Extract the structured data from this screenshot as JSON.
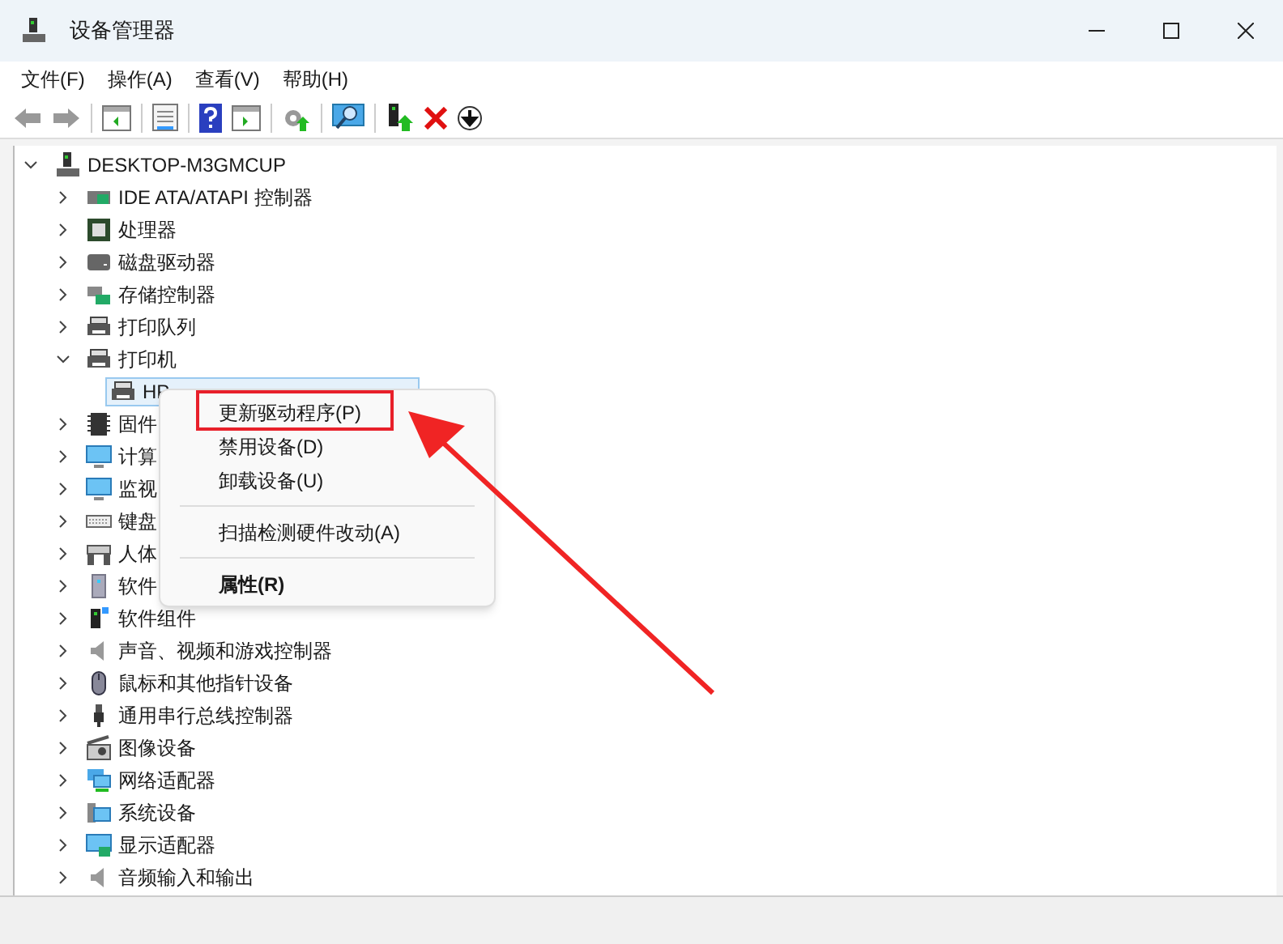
{
  "window": {
    "title": "设备管理器"
  },
  "menu_bar": [
    "文件(F)",
    "操作(A)",
    "查看(V)",
    "帮助(H)"
  ],
  "tree": {
    "label": "DESKTOP-M3GMCUP",
    "expanded": true,
    "children": [
      {
        "label": "IDE ATA/ATAPI 控制器",
        "expanded": false
      },
      {
        "label": "处理器",
        "expanded": false
      },
      {
        "label": "磁盘驱动器",
        "expanded": false
      },
      {
        "label": "存储控制器",
        "expanded": false
      },
      {
        "label": "打印队列",
        "expanded": false
      },
      {
        "label": "打印机",
        "expanded": true,
        "children": [
          {
            "label": "HP",
            "selected": true
          }
        ]
      },
      {
        "label": "固件",
        "expanded": false
      },
      {
        "label": "计算",
        "expanded": false
      },
      {
        "label": "监视",
        "expanded": false
      },
      {
        "label": "键盘",
        "expanded": false
      },
      {
        "label": "人体",
        "expanded": false
      },
      {
        "label": "软件",
        "expanded": false
      },
      {
        "label": "软件组件",
        "expanded": false
      },
      {
        "label": "声音、视频和游戏控制器",
        "expanded": false
      },
      {
        "label": "鼠标和其他指针设备",
        "expanded": false
      },
      {
        "label": "通用串行总线控制器",
        "expanded": false
      },
      {
        "label": "图像设备",
        "expanded": false
      },
      {
        "label": "网络适配器",
        "expanded": false
      },
      {
        "label": "系统设备",
        "expanded": false
      },
      {
        "label": "显示适配器",
        "expanded": false
      },
      {
        "label": "音频输入和输出",
        "expanded": false
      }
    ]
  },
  "context_menu": [
    {
      "kind": "item",
      "label": "更新驱动程序(P)",
      "bold": false
    },
    {
      "kind": "item",
      "label": "禁用设备(D)",
      "bold": false
    },
    {
      "kind": "item",
      "label": "卸载设备(U)",
      "bold": false
    },
    {
      "kind": "separator"
    },
    {
      "kind": "item",
      "label": "扫描检测硬件改动(A)",
      "bold": false
    },
    {
      "kind": "separator"
    },
    {
      "kind": "item",
      "label": "属性(R)",
      "bold": true
    }
  ]
}
